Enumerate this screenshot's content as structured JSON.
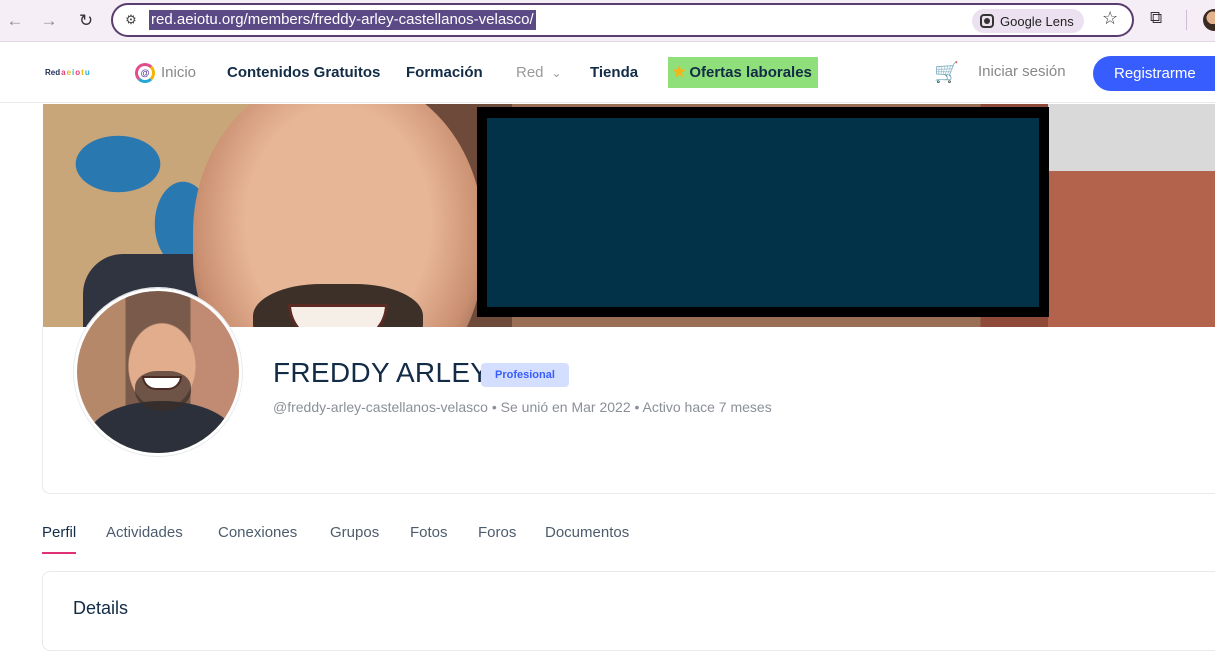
{
  "browser": {
    "url": "red.aeiotu.org/members/freddy-arley-castellanos-velasco/",
    "lens_label": "Google Lens"
  },
  "header": {
    "logo_text": [
      "Red",
      "a",
      "e",
      "i",
      "o",
      "t",
      "u"
    ],
    "menu": {
      "inicio": "Inicio",
      "contenidos": "Contenidos Gratuitos",
      "formacion": "Formación",
      "red": "Red",
      "tienda": "Tienda",
      "ofertas": "Ofertas laborales"
    },
    "login": "Iniciar sesión",
    "signup": "Registrarme"
  },
  "profile": {
    "name": "FREDDY ARLEY",
    "badge": "Profesional",
    "meta": "@freddy-arley-castellanos-velasco • Se unió en Mar 2022 • Activo hace 7 meses"
  },
  "tabs": [
    "Perfil",
    "Actividades",
    "Conexiones",
    "Grupos",
    "Fotos",
    "Foros",
    "Documentos"
  ],
  "details": {
    "title": "Details"
  },
  "colors": {
    "accent": "#385dff",
    "tab_active": "#e03177",
    "ofertas_bg": "#8fe07a",
    "redaction": "#023247"
  }
}
